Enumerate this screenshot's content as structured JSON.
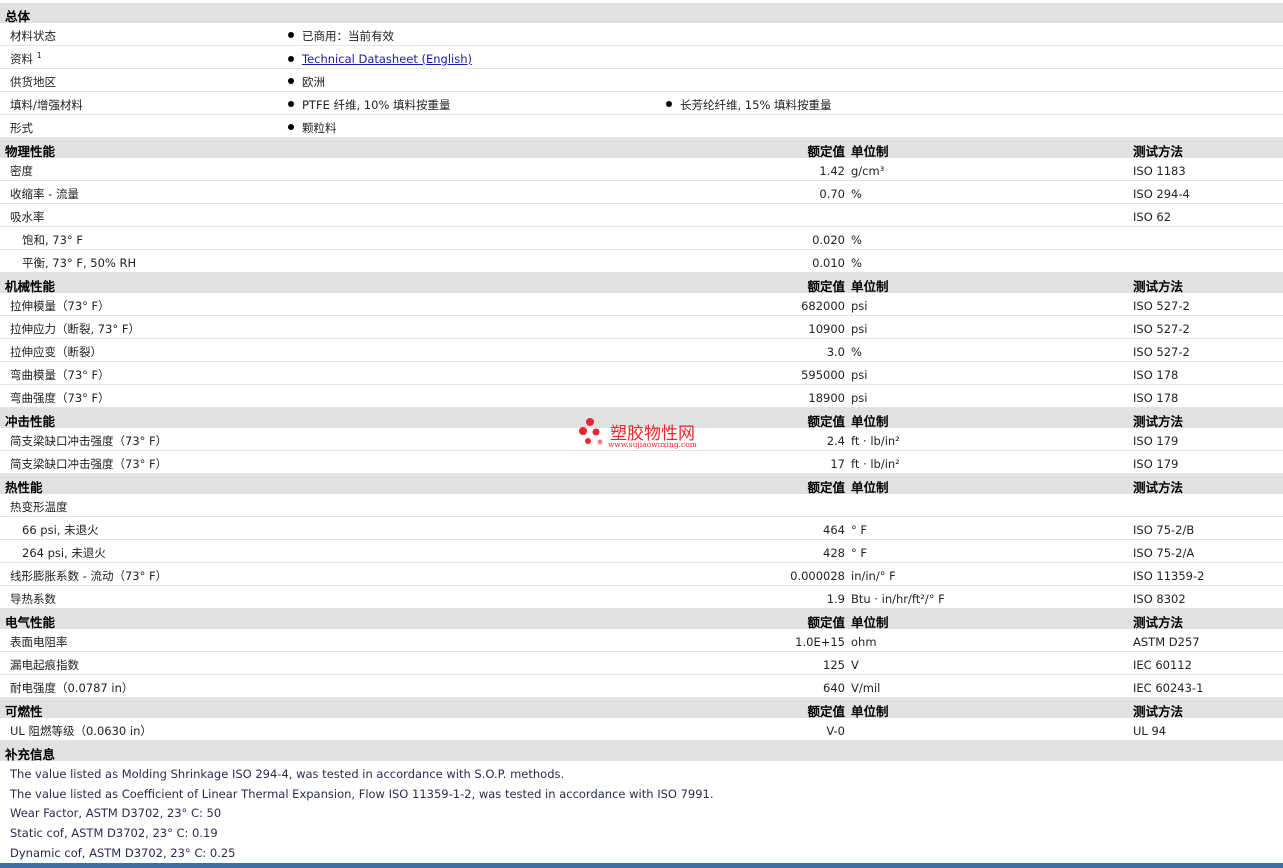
{
  "general": {
    "title": "总体",
    "rows": [
      {
        "label": "材料状态",
        "values": [
          "已商用：当前有效"
        ]
      },
      {
        "label": "资料",
        "label_sup": "1",
        "values": [
          "Technical Datasheet (English)"
        ]
      },
      {
        "label": "供货地区",
        "values": [
          "欧洲"
        ]
      },
      {
        "label": "填料/增强材料",
        "values": [
          "PTFE 纤维, 10% 填料按重量",
          "长芳纶纤维, 15% 填料按重量"
        ]
      },
      {
        "label": "形式",
        "values": [
          "颗粒料"
        ]
      }
    ]
  },
  "columns": {
    "value": "额定值",
    "unit": "单位制",
    "method": "测试方法"
  },
  "physical": {
    "title": "物理性能",
    "rows": [
      {
        "label": "密度",
        "value": "1.42",
        "unit": "g/cm³",
        "method": "ISO 1183"
      },
      {
        "label": "收缩率 - 流量",
        "value": "0.70",
        "unit": "%",
        "method": "ISO 294-4"
      },
      {
        "label": "吸水率",
        "value": "",
        "unit": "",
        "method": "ISO 62"
      },
      {
        "label": "饱和, 73° F",
        "value": "0.020",
        "unit": "%",
        "method": ""
      },
      {
        "label": "平衡, 73° F, 50% RH",
        "value": "0.010",
        "unit": "%",
        "method": ""
      }
    ]
  },
  "mechanical": {
    "title": "机械性能",
    "rows": [
      {
        "label": "拉伸模量（73° F）",
        "value": "682000",
        "unit": "psi",
        "method": "ISO 527-2"
      },
      {
        "label": "拉伸应力（断裂, 73° F）",
        "value": "10900",
        "unit": "psi",
        "method": "ISO 527-2"
      },
      {
        "label": "拉伸应变（断裂）",
        "value": "3.0",
        "unit": "%",
        "method": "ISO 527-2"
      },
      {
        "label": "弯曲模量（73° F）",
        "value": "595000",
        "unit": "psi",
        "method": "ISO 178"
      },
      {
        "label": "弯曲强度（73° F）",
        "value": "18900",
        "unit": "psi",
        "method": "ISO 178"
      }
    ]
  },
  "impact": {
    "title": "冲击性能",
    "rows": [
      {
        "label": "简支梁缺口冲击强度（73° F）",
        "value": "2.4",
        "unit": "ft · lb/in²",
        "method": "ISO 179"
      },
      {
        "label": "简支梁缺口冲击强度（73° F）",
        "value": "17",
        "unit": "ft · lb/in²",
        "method": "ISO 179"
      }
    ]
  },
  "thermal": {
    "title": "热性能",
    "rows": [
      {
        "label": "热变形温度",
        "value": "",
        "unit": "",
        "method": ""
      },
      {
        "label": "66 psi, 未退火",
        "value": "464",
        "unit": "° F",
        "method": "ISO 75-2/B"
      },
      {
        "label": "264 psi, 未退火",
        "value": "428",
        "unit": "° F",
        "method": "ISO 75-2/A"
      },
      {
        "label": "线形膨胀系数 - 流动（73° F）",
        "value": "0.000028",
        "unit": "in/in/° F",
        "method": "ISO 11359-2"
      },
      {
        "label": "导热系数",
        "value": "1.9",
        "unit": "Btu · in/hr/ft²/° F",
        "method": "ISO 8302"
      }
    ]
  },
  "electrical": {
    "title": "电气性能",
    "rows": [
      {
        "label": "表面电阻率",
        "value": "1.0E+15",
        "unit": "ohm",
        "method": "ASTM D257"
      },
      {
        "label": "漏电起痕指数",
        "value": "125",
        "unit": "V",
        "method": "IEC 60112"
      },
      {
        "label": "耐电强度（0.0787 in）",
        "value": "640",
        "unit": "V/mil",
        "method": "IEC 60243-1"
      }
    ]
  },
  "flammability": {
    "title": "可燃性",
    "rows": [
      {
        "label": "UL 阻燃等级（0.0630 in）",
        "value": "V-0",
        "unit": "",
        "method": "UL 94"
      }
    ]
  },
  "supplemental": {
    "title": "补充信息",
    "notes": [
      "The value listed as Molding Shrinkage ISO 294-4, was tested in accordance with S.O.P. methods.",
      "The value listed as Coefficient of Linear Thermal Expansion, Flow ISO 11359-1-2, was tested in accordance with ISO 7991.",
      "Wear Factor, ASTM D3702, 23° C: 50",
      "Static cof, ASTM D3702, 23° C: 0.19",
      "Dynamic cof, ASTM D3702, 23° C: 0.25"
    ]
  },
  "watermark": {
    "title": "塑胶物性网",
    "url": "www.sujiaowuxing.com",
    "color": "#e8262c"
  }
}
